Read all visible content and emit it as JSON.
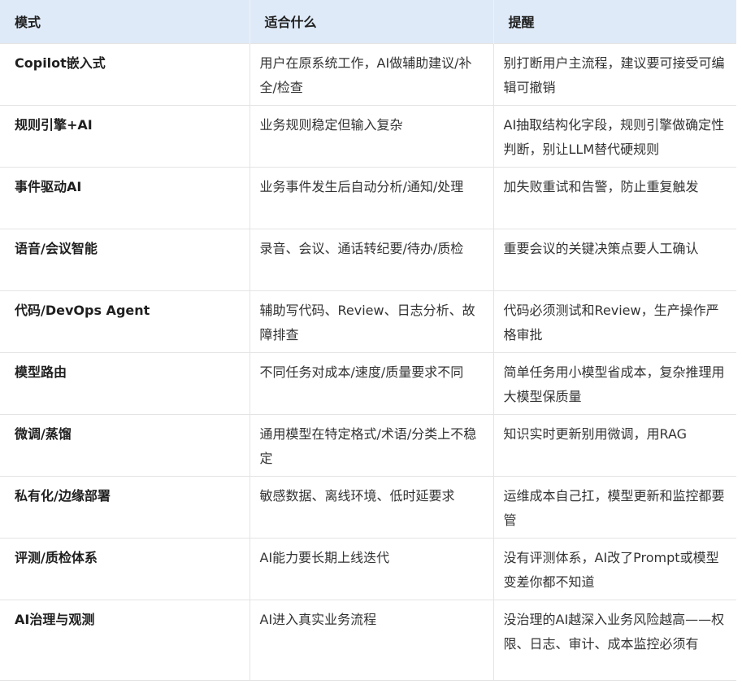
{
  "table": {
    "headers": [
      "模式",
      "适合什么",
      "提醒"
    ],
    "rows": [
      {
        "mode": "Copilot嵌入式",
        "fit": "用户在原系统工作，AI做辅助建议/补全/检查",
        "note": "别打断用户主流程，建议要可接受可编辑可撤销"
      },
      {
        "mode": "规则引擎+AI",
        "fit": "业务规则稳定但输入复杂",
        "note": "AI抽取结构化字段，规则引擎做确定性判断，别让LLM替代硬规则"
      },
      {
        "mode": "事件驱动AI",
        "fit": "业务事件发生后自动分析/通知/处理",
        "note": "加失败重试和告警，防止重复触发"
      },
      {
        "mode": "语音/会议智能",
        "fit": "录音、会议、通话转纪要/待办/质检",
        "note": "重要会议的关键决策点要人工确认"
      },
      {
        "mode": "代码/DevOps Agent",
        "fit": "辅助写代码、Review、日志分析、故障排查",
        "note": "代码必须测试和Review，生产操作严格审批"
      },
      {
        "mode": "模型路由",
        "fit": "不同任务对成本/速度/质量要求不同",
        "note": "简单任务用小模型省成本，复杂推理用大模型保质量"
      },
      {
        "mode": "微调/蒸馏",
        "fit": "通用模型在特定格式/术语/分类上不稳定",
        "note": "知识实时更新别用微调，用RAG"
      },
      {
        "mode": "私有化/边缘部署",
        "fit": "敏感数据、离线环境、低时延要求",
        "note": "运维成本自己扛，模型更新和监控都要管"
      },
      {
        "mode": "评测/质检体系",
        "fit": "AI能力要长期上线迭代",
        "note": "没有评测体系，AI改了Prompt或模型变差你都不知道"
      },
      {
        "mode": "AI治理与观测",
        "fit": "AI进入真实业务流程",
        "note": "没治理的AI越深入业务风险越高——权限、日志、审计、成本监控必须有"
      }
    ]
  }
}
